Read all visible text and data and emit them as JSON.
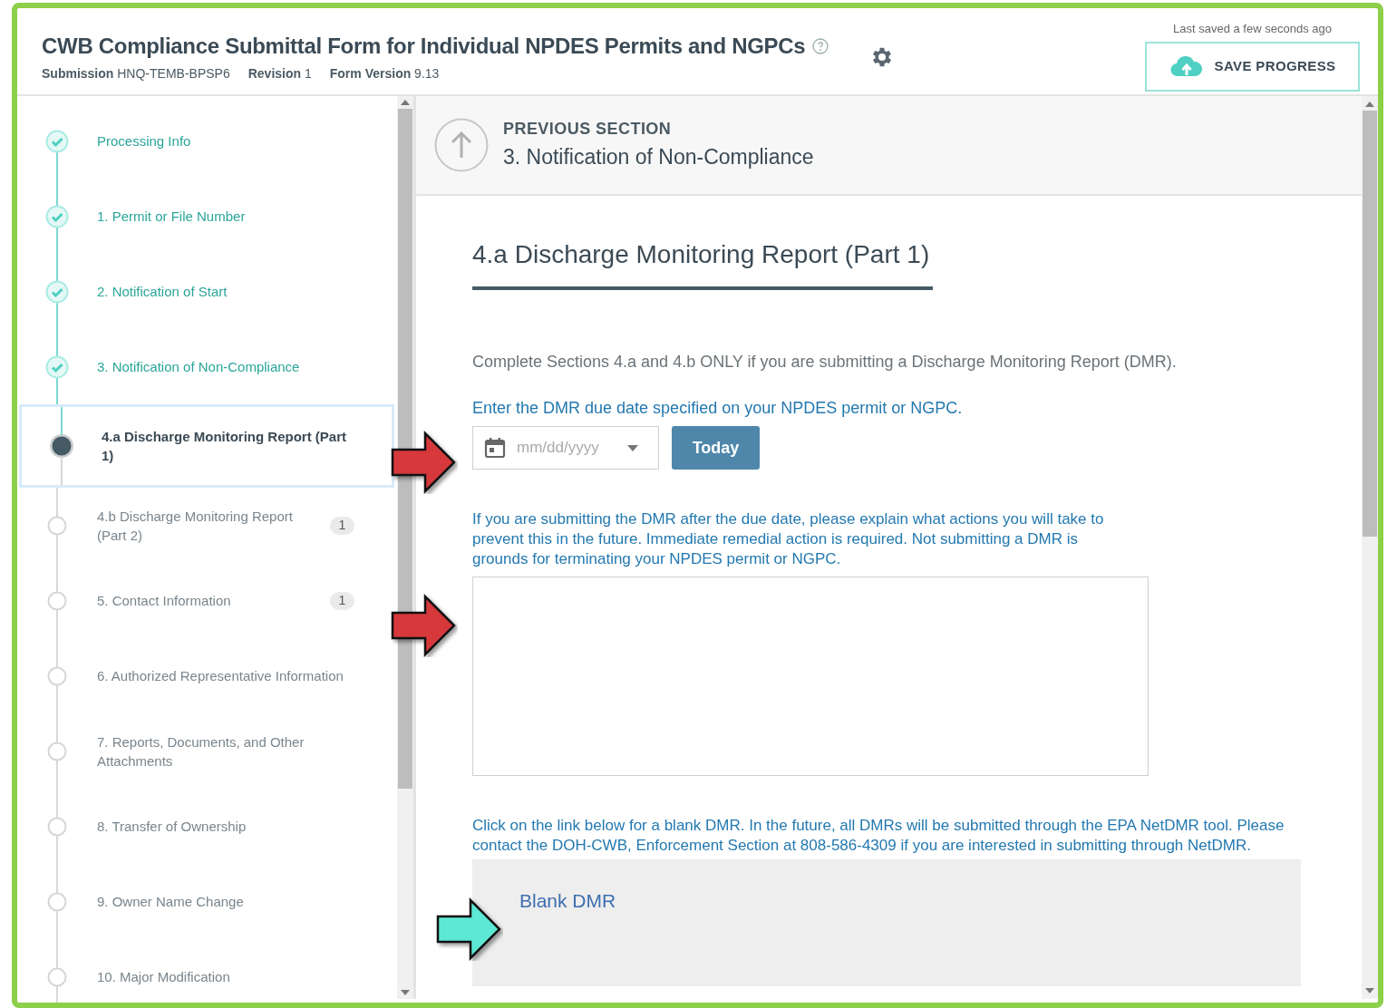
{
  "header": {
    "title": "CWB Compliance Submittal Form for Individual NPDES Permits and NGPCs",
    "meta": [
      {
        "label": "Submission",
        "value": "HNQ-TEMB-BPSP6"
      },
      {
        "label": "Revision",
        "value": "1"
      },
      {
        "label": "Form Version",
        "value": "9.13"
      }
    ],
    "last_saved": "Last saved a few seconds ago",
    "save_button": "SAVE PROGRESS"
  },
  "sidebar": {
    "items": [
      {
        "label": "Processing Info",
        "kind": "done",
        "selected": false
      },
      {
        "label": "1. Permit or File Number",
        "kind": "done",
        "selected": false
      },
      {
        "label": "2. Notification of Start",
        "kind": "done",
        "selected": false
      },
      {
        "label": "3. Notification of Non-Compliance",
        "kind": "done",
        "selected": false
      },
      {
        "label": "4.a Discharge Monitoring Report (Part 1)",
        "kind": "current",
        "selected": true
      },
      {
        "label": "4.b Discharge Monitoring Report (Part 2)",
        "kind": "todo",
        "selected": false,
        "badge": "1"
      },
      {
        "label": "5. Contact Information",
        "kind": "todo",
        "selected": false,
        "badge": "1"
      },
      {
        "label": "6. Authorized Representative Information",
        "kind": "todo",
        "selected": false
      },
      {
        "label": "7. Reports, Documents, and Other Attachments",
        "kind": "todo",
        "selected": false
      },
      {
        "label": "8. Transfer of Ownership",
        "kind": "todo",
        "selected": false
      },
      {
        "label": "9. Owner Name Change",
        "kind": "todo",
        "selected": false
      },
      {
        "label": "10. Major Modification",
        "kind": "todo",
        "selected": false
      }
    ]
  },
  "previous_section": {
    "caption": "PREVIOUS SECTION",
    "title": "3. Notification of Non-Compliance"
  },
  "section": {
    "heading": "4.a Discharge Monitoring Report (Part 1)",
    "intro": "Complete Sections 4.a and 4.b ONLY if you are submitting a Discharge Monitoring Report (DMR).",
    "date_label": "Enter the DMR due date specified on your NPDES permit or NGPC.",
    "date_field": {
      "placeholder": "mm/dd/yyyy"
    },
    "today_button": "Today",
    "explain_label": "If you are submitting the DMR after the due date, please explain what actions you will take to prevent this in the future. Immediate remedial action is required. Not submitting a DMR is grounds for terminating your NPDES permit or NGPC.",
    "link_note": "Click on the link below for a blank DMR. In the future, all DMRs will be submitted through the EPA NetDMR tool. Please contact the DOH-CWB, Enforcement Section at 808-586-4309 if you are interested in submitting through NetDMR.",
    "link": "Blank DMR"
  },
  "annotations": [
    {
      "color": "#d6383b"
    },
    {
      "color": "#d6383b"
    },
    {
      "color": "#5ce8d4"
    }
  ]
}
